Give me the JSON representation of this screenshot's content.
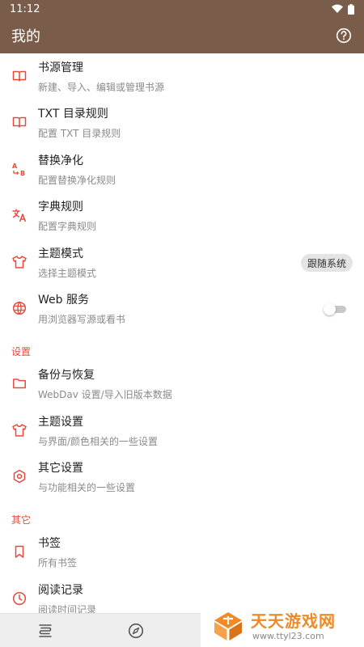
{
  "status_bar": {
    "time": "11:12",
    "icons": [
      "wifi-icon",
      "battery-icon"
    ]
  },
  "app_bar": {
    "title": "我的",
    "help_icon": "help-circle-icon"
  },
  "colors": {
    "app_bar_bg": "#7a5c4a",
    "accent": "#e64a3b",
    "watermark_orange": "#f08a24"
  },
  "menu": {
    "book_source": {
      "title": "书源管理",
      "subtitle": "新建、导入、编辑或管理书源",
      "icon": "book-open-icon"
    },
    "txt_toc": {
      "title": "TXT 目录规则",
      "subtitle": "配置 TXT 目录规则",
      "icon": "book-open-icon"
    },
    "replace": {
      "title": "替换净化",
      "subtitle": "配置替换净化规则",
      "icon": "replace-ab-icon"
    },
    "dict": {
      "title": "字典规则",
      "subtitle": "配置字典规则",
      "icon": "translate-icon"
    },
    "theme_mode": {
      "title": "主题模式",
      "subtitle": "选择主题模式",
      "icon": "shirt-icon",
      "value": "跟随系统"
    },
    "web_service": {
      "title": "Web 服务",
      "subtitle": "用浏览器写源或看书",
      "icon": "globe-icon",
      "enabled": false
    }
  },
  "sections": {
    "settings": "设置",
    "other": "其它"
  },
  "settings": {
    "backup": {
      "title": "备份与恢复",
      "subtitle": "WebDav 设置/导入旧版本数据",
      "icon": "folder-icon"
    },
    "theme": {
      "title": "主题设置",
      "subtitle": "与界面/颜色相关的一些设置",
      "icon": "shirt-icon"
    },
    "other": {
      "title": "其它设置",
      "subtitle": "与功能相关的一些设置",
      "icon": "gear-icon"
    }
  },
  "other": {
    "bookmark": {
      "title": "书签",
      "subtitle": "所有书签",
      "icon": "bookmark-icon"
    },
    "read_record": {
      "title": "阅读记录",
      "subtitle": "阅读时间记录",
      "icon": "clock-icon"
    }
  },
  "bottom_nav": {
    "icons": [
      "bookshelf-icon",
      "compass-icon"
    ]
  },
  "watermark": {
    "title": "天天游戏网",
    "url": "www.ttyl23.com"
  }
}
